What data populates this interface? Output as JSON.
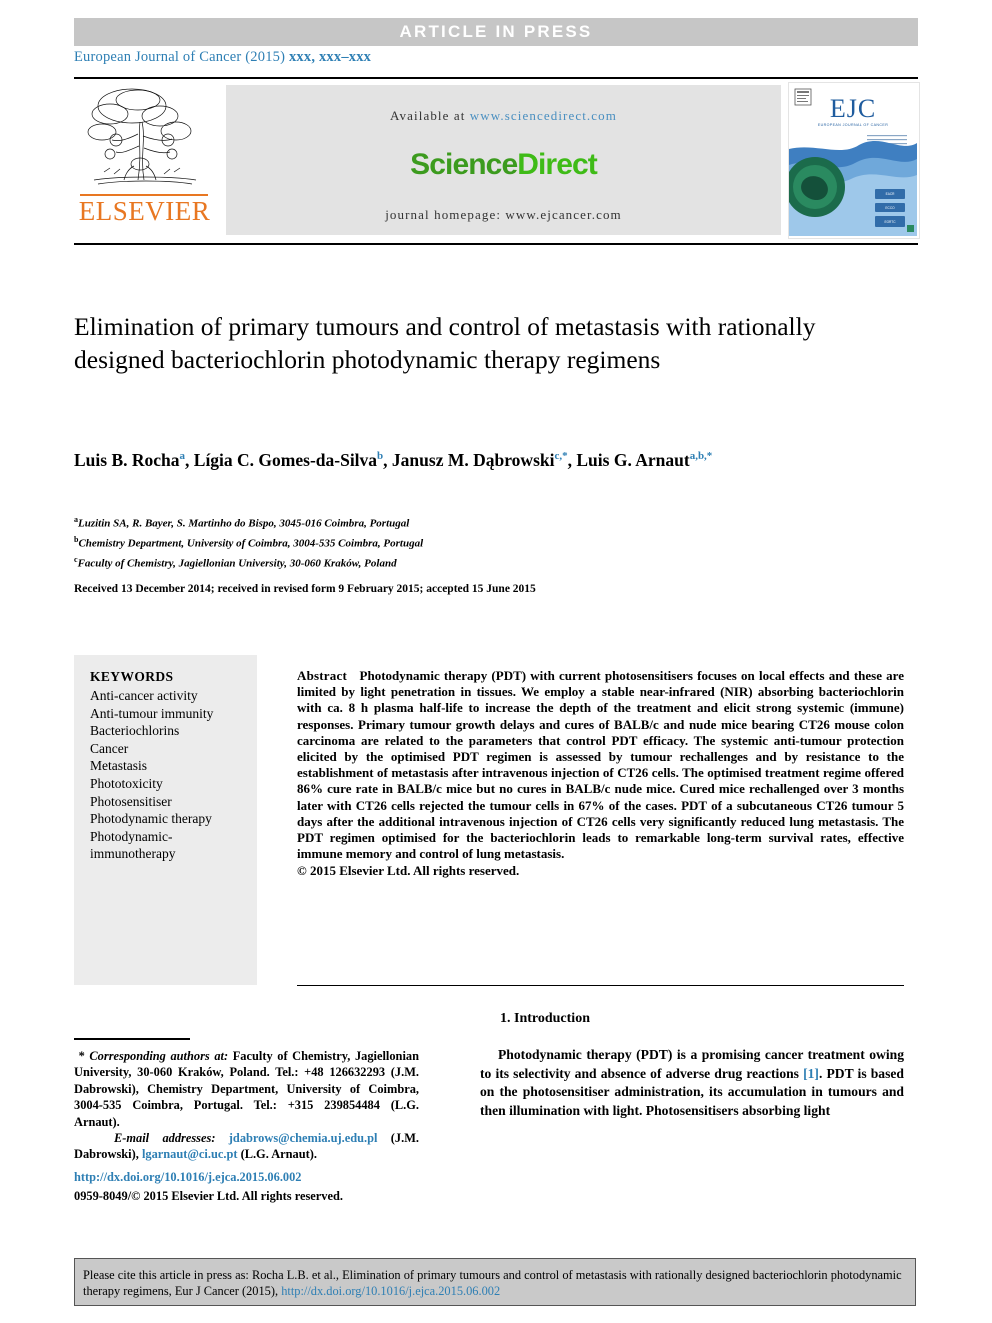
{
  "banner": {
    "text": "ARTICLE  IN  PRESS"
  },
  "journal_ref": {
    "name": "European Journal of Cancer (2015)",
    "volume_pages": "xxx, xxx–xxx"
  },
  "masthead": {
    "publisher_name": "ELSEVIER",
    "available_at_label": "Available at",
    "available_at_url": "www.sciencedirect.com",
    "sciencedirect_part1": "Science",
    "sciencedirect_part2": "Direct",
    "homepage_label": "journal homepage:",
    "homepage_url": "www.ejcancer.com",
    "cover_logo": "EJC",
    "cover_subtitle": "EUROPEAN JOURNAL OF CANCER"
  },
  "article": {
    "title": "Elimination of primary tumours and control of metastasis with rationally designed bacteriochlorin photodynamic therapy regimens",
    "authors_line": "Luis B. Rocha a, Lígia C. Gomes-da-Silva b, Janusz M. Dąbrowski c,*, Luis G. Arnaut a,b,*",
    "authors": [
      {
        "name": "Luis B. Rocha",
        "marks": "a"
      },
      {
        "name": "Lígia C. Gomes-da-Silva",
        "marks": "b"
      },
      {
        "name": "Janusz M. Dąbrowski",
        "marks": "c,*"
      },
      {
        "name": "Luis G. Arnaut",
        "marks": "a,b,*"
      }
    ],
    "affiliations": [
      {
        "mark": "a",
        "text": "Luzitin SA, R. Bayer, S. Martinho do Bispo, 3045-016 Coimbra, Portugal"
      },
      {
        "mark": "b",
        "text": "Chemistry Department, University of Coimbra, 3004-535 Coimbra, Portugal"
      },
      {
        "mark": "c",
        "text": "Faculty of Chemistry, Jagiellonian University, 30-060 Kraków, Poland"
      }
    ],
    "history": "Received 13 December 2014; received in revised form 9 February 2015; accepted 15 June 2015"
  },
  "keywords": {
    "heading": "KEYWORDS",
    "items": [
      "Anti-cancer activity",
      "Anti-tumour immunity",
      "Bacteriochlorins",
      "Cancer",
      "Metastasis",
      "Phototoxicity",
      "Photosensitiser",
      "Photodynamic therapy",
      "Photodynamic-",
      "immunotherapy"
    ]
  },
  "abstract": {
    "label": "Abstract",
    "body": "Photodynamic therapy (PDT) with current photosensitisers focuses on local effects and these are limited by light penetration in tissues. We employ a stable near-infrared (NIR) absorbing bacteriochlorin with ca. 8 h plasma half-life to increase the depth of the treatment and elicit strong systemic (immune) responses. Primary tumour growth delays and cures of BALB/c and nude mice bearing CT26 mouse colon carcinoma are related to the parameters that control PDT efficacy. The systemic anti-tumour protection elicited by the optimised PDT regimen is assessed by tumour rechallenges and by resistance to the establishment of metastasis after intravenous injection of CT26 cells. The optimised treatment regime offered 86% cure rate in BALB/c mice but no cures in BALB/c nude mice. Cured mice rechallenged over 3 months later with CT26 cells rejected the tumour cells in 67% of the cases. PDT of a subcutaneous CT26 tumour 5 days after the additional intravenous injection of CT26 cells very significantly reduced lung metastasis. The PDT regimen optimised for the bacteriochlorin leads to remarkable long-term survival rates, effective immune memory and control of lung metastasis.",
    "copyright": "© 2015 Elsevier Ltd. All rights reserved."
  },
  "introduction": {
    "heading": "1.  Introduction",
    "paragraph_pre_ref": "Photodynamic therapy (PDT) is a promising cancer treatment owing to its selectivity and absence of adverse drug reactions ",
    "reference_marker": "[1]",
    "paragraph_post_ref": ". PDT is based on the photosensitiser administration, its accumulation in tumours and then illumination with light. Photosensitisers absorbing light"
  },
  "footnote": {
    "star": "*",
    "corresponding_label": "Corresponding authors at:",
    "corresponding_text": " Faculty of Chemistry, Jagiellonian University, 30-060 Kraków, Poland. Tel.: +48 126632293 (J.M. Dabrowski), Chemistry Department, University of Coimbra, 3004-535 Coimbra, Portugal. Tel.: +315 239854484 (L.G. Arnaut).",
    "email_label": "E-mail addresses:",
    "email_1": "jdabrows@chemia.uj.edu.pl",
    "email_1_owner": " (J.M. Dabrowski),",
    "email_2": "lgarnaut@ci.uc.pt",
    "email_2_owner": " (L.G. Arnaut)."
  },
  "footer": {
    "doi_url": "http://dx.doi.org/10.1016/j.ejca.2015.06.002",
    "issn_copyright": "0959-8049/© 2015 Elsevier Ltd. All rights reserved."
  },
  "citation_box": {
    "text_part1": "Please cite this article in press as: Rocha L.B. et al., Elimination of primary tumours and control of metastasis with rationally designed bacteriochlorin photodynamic therapy regimens, Eur J Cancer (2015), ",
    "doi_url": "http://dx.doi.org/10.1016/j.ejca.2015.06.002"
  },
  "colors": {
    "banner_bg": "#c6c6c6",
    "link_blue": "#2e7fb4",
    "elsevier_orange": "#E87722",
    "sciencedirect_green": "#3fbb17",
    "sd_panel_bg": "#e3e3e3",
    "keyword_panel_bg": "#ececec",
    "citation_bg": "#c9c9c9"
  }
}
